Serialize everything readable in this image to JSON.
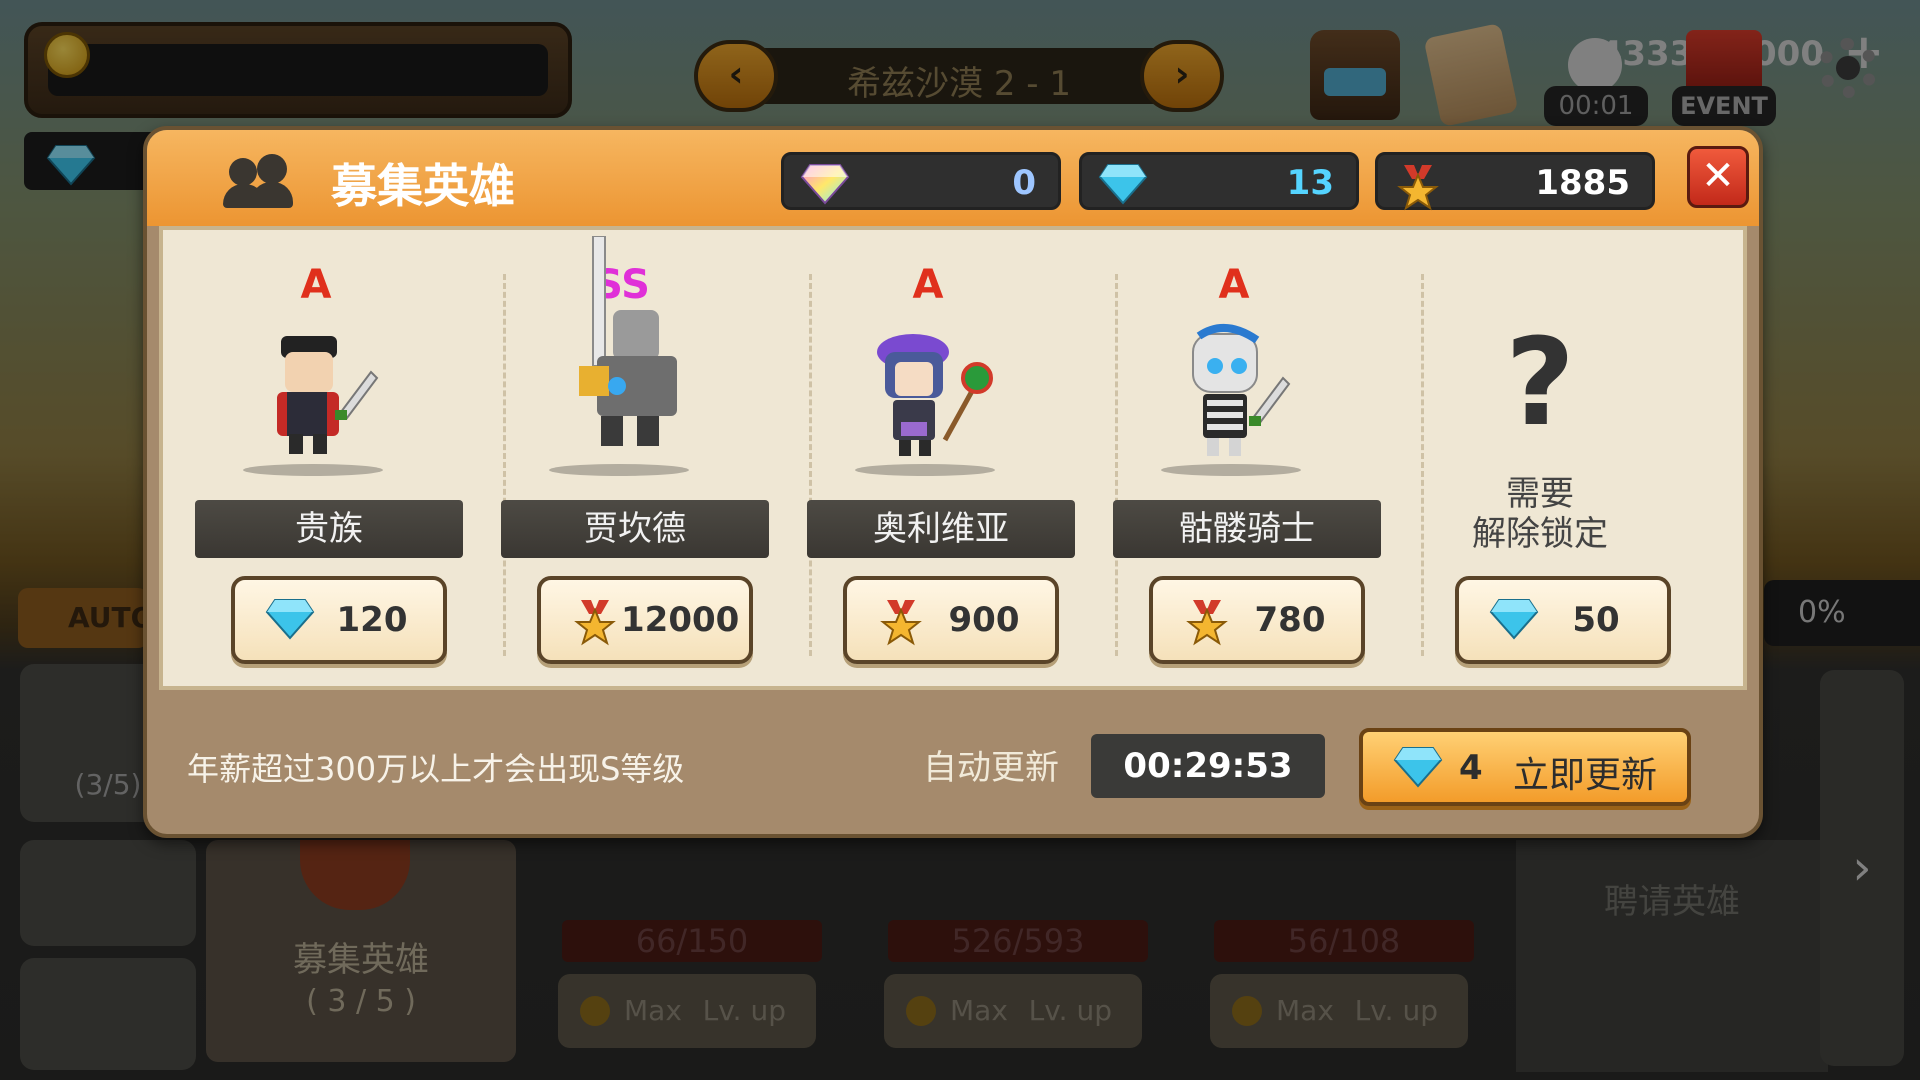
{
  "hud": {
    "gold": "4333/13000",
    "gold_plus": "+",
    "stage": "希兹沙漠 2 - 1",
    "timer_badge": "00:01",
    "event_badge": "EVENT",
    "auto": "AUTO",
    "percent": "0%"
  },
  "background": {
    "side_count": "(3/5)",
    "recruit_label": "募集英雄",
    "recruit_count": "( 3 / 5 )",
    "hire_label": "聘请英雄",
    "cards": [
      {
        "hp": "66/150",
        "max": "Max",
        "lv": "Lv. up"
      },
      {
        "hp": "526/593",
        "max": "Max",
        "lv": "Lv. up"
      },
      {
        "hp": "56/108",
        "max": "Max",
        "lv": "Lv. up"
      }
    ]
  },
  "modal": {
    "title": "募集英雄",
    "currencies": {
      "crystal": "0",
      "gem": "13",
      "medal": "1885"
    },
    "close": "✕",
    "slots": [
      {
        "grade": "A",
        "name": "贵族",
        "currency": "gem",
        "price": "120"
      },
      {
        "grade": "SS",
        "name": "贾坎德",
        "currency": "medal",
        "price": "12000"
      },
      {
        "grade": "A",
        "name": "奥利维亚",
        "currency": "medal",
        "price": "900"
      },
      {
        "grade": "A",
        "name": "骷髅骑士",
        "currency": "medal",
        "price": "780"
      },
      {
        "grade": "",
        "name": "",
        "locked_symbol": "?",
        "locked_line1": "需要",
        "locked_line2": "解除锁定",
        "currency": "gem",
        "price": "50"
      }
    ],
    "footer_note": "年薪超过300万以上才会出现S等级",
    "auto_refresh_label": "自动更新",
    "auto_refresh_timer": "00:29:53",
    "refresh_cost": "4",
    "refresh_label": "立即更新"
  },
  "colors": {
    "header": "#ee9a36",
    "panel": "#efe7d4",
    "gem": "#37c2e8",
    "grade_a": "#e0301c",
    "grade_ss": "#e030d8"
  }
}
